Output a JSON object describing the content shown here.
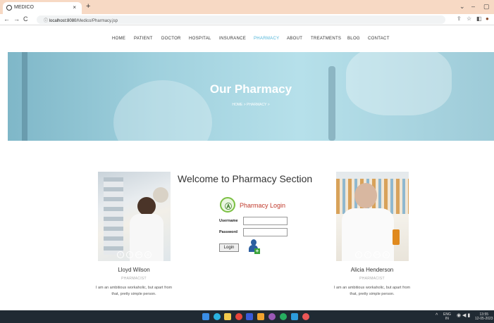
{
  "browser": {
    "tab_title": "MEDICO",
    "tab_close": "×",
    "new_tab": "+",
    "url_host": "localhost:8080",
    "url_path": "/Medico/Pharmacy.jsp",
    "win_controls": [
      "⌄",
      "–",
      "▢"
    ]
  },
  "nav": {
    "items": [
      "HOME",
      "PATIENT",
      "DOCTOR",
      "HOSPITAL",
      "INSURANCE",
      "PHARMACY",
      "ABOUT",
      "TREATMENTS",
      "BLOG",
      "CONTACT"
    ],
    "active": "PHARMACY"
  },
  "hero": {
    "title": "Our Pharmacy",
    "breadcrumb": "HOME > PHARMACY >"
  },
  "welcome": "Welcome to Pharmacy Section",
  "login": {
    "title": "Pharmacy Login",
    "username_label": "Username",
    "password_label": "Password",
    "username_value": "",
    "password_value": "",
    "button": "Login"
  },
  "people": [
    {
      "name": "Lloyd Wilson",
      "role": "PHARMACIST",
      "desc": "I am an ambitious workaholic, but apart from that, pretty simple person."
    },
    {
      "name": "Alicia Henderson",
      "role": "PHARMACIST",
      "desc": "I am an ambitious workaholic, but apart from that, pretty simple person."
    }
  ],
  "social_icons": [
    "twitter-icon",
    "facebook-icon",
    "google-plus-icon",
    "instagram-icon"
  ],
  "social_glyphs": [
    "t",
    "f",
    "G+",
    "◎"
  ],
  "taskbar": {
    "lang": "ENG",
    "region": "IN",
    "time": "13:55",
    "date": "12-05-2023"
  },
  "colors": {
    "accent": "#4fb4d8",
    "login_title": "#c0392b",
    "taskbar": "#202a33"
  }
}
